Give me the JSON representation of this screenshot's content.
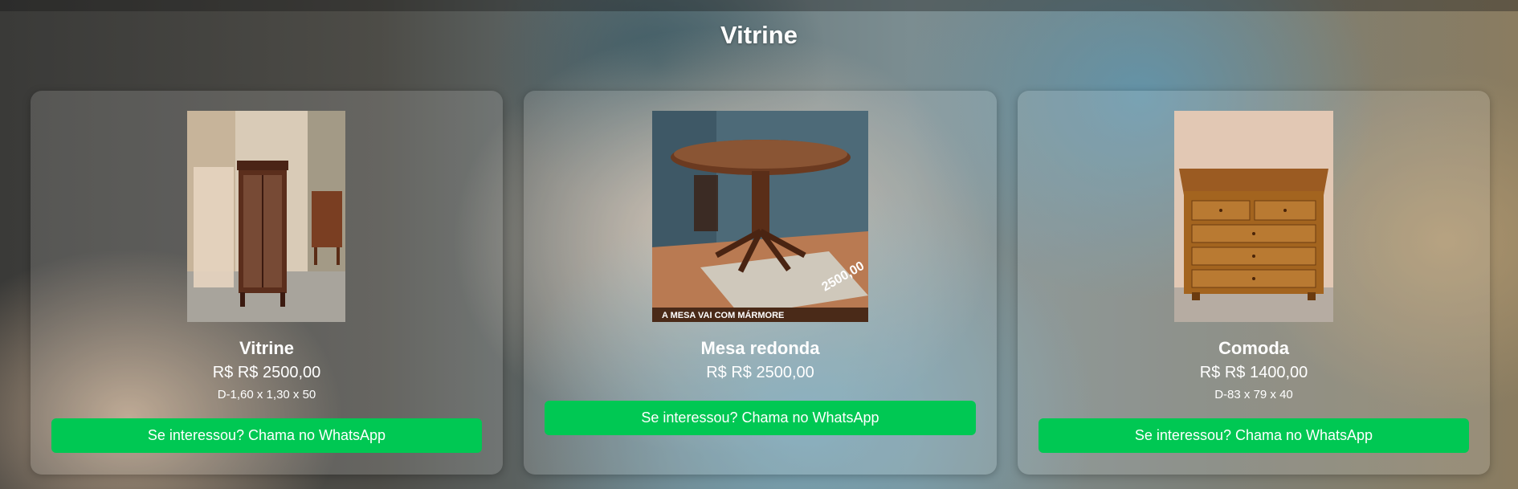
{
  "page": {
    "title": "Vitrine"
  },
  "products": [
    {
      "name": "Vitrine",
      "price": "R$ R$ 2500,00",
      "dimensions": "D-1,60 x 1,30 x 50",
      "button_label": "Se interessou? Chama no WhatsApp"
    },
    {
      "name": "Mesa redonda",
      "price": "R$ R$ 2500,00",
      "image_caption": "A MESA VAI COM MÁRMORE",
      "image_price_tag": "2500,00",
      "button_label": "Se interessou? Chama no WhatsApp"
    },
    {
      "name": "Comoda",
      "price": "R$ R$ 1400,00",
      "dimensions": "D-83 x 79 x 40",
      "button_label": "Se interessou? Chama no WhatsApp"
    }
  ],
  "colors": {
    "button_green": "#00c853",
    "text": "#ffffff"
  }
}
